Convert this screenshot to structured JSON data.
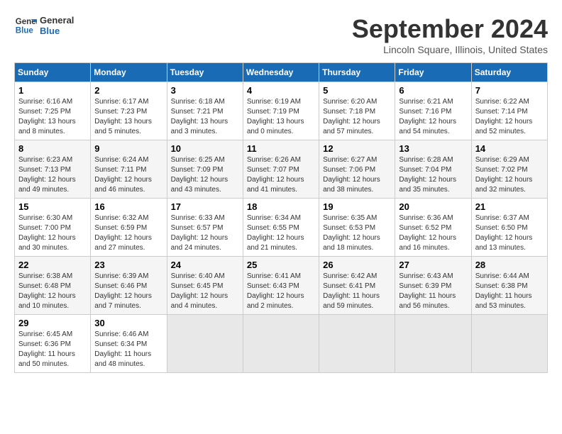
{
  "logo": {
    "line1": "General",
    "line2": "Blue"
  },
  "title": "September 2024",
  "location": "Lincoln Square, Illinois, United States",
  "headers": [
    "Sunday",
    "Monday",
    "Tuesday",
    "Wednesday",
    "Thursday",
    "Friday",
    "Saturday"
  ],
  "weeks": [
    [
      {
        "day": "1",
        "sunrise": "6:16 AM",
        "sunset": "7:25 PM",
        "daylight": "13 hours and 8 minutes."
      },
      {
        "day": "2",
        "sunrise": "6:17 AM",
        "sunset": "7:23 PM",
        "daylight": "13 hours and 5 minutes."
      },
      {
        "day": "3",
        "sunrise": "6:18 AM",
        "sunset": "7:21 PM",
        "daylight": "13 hours and 3 minutes."
      },
      {
        "day": "4",
        "sunrise": "6:19 AM",
        "sunset": "7:19 PM",
        "daylight": "13 hours and 0 minutes."
      },
      {
        "day": "5",
        "sunrise": "6:20 AM",
        "sunset": "7:18 PM",
        "daylight": "12 hours and 57 minutes."
      },
      {
        "day": "6",
        "sunrise": "6:21 AM",
        "sunset": "7:16 PM",
        "daylight": "12 hours and 54 minutes."
      },
      {
        "day": "7",
        "sunrise": "6:22 AM",
        "sunset": "7:14 PM",
        "daylight": "12 hours and 52 minutes."
      }
    ],
    [
      {
        "day": "8",
        "sunrise": "6:23 AM",
        "sunset": "7:13 PM",
        "daylight": "12 hours and 49 minutes."
      },
      {
        "day": "9",
        "sunrise": "6:24 AM",
        "sunset": "7:11 PM",
        "daylight": "12 hours and 46 minutes."
      },
      {
        "day": "10",
        "sunrise": "6:25 AM",
        "sunset": "7:09 PM",
        "daylight": "12 hours and 43 minutes."
      },
      {
        "day": "11",
        "sunrise": "6:26 AM",
        "sunset": "7:07 PM",
        "daylight": "12 hours and 41 minutes."
      },
      {
        "day": "12",
        "sunrise": "6:27 AM",
        "sunset": "7:06 PM",
        "daylight": "12 hours and 38 minutes."
      },
      {
        "day": "13",
        "sunrise": "6:28 AM",
        "sunset": "7:04 PM",
        "daylight": "12 hours and 35 minutes."
      },
      {
        "day": "14",
        "sunrise": "6:29 AM",
        "sunset": "7:02 PM",
        "daylight": "12 hours and 32 minutes."
      }
    ],
    [
      {
        "day": "15",
        "sunrise": "6:30 AM",
        "sunset": "7:00 PM",
        "daylight": "12 hours and 30 minutes."
      },
      {
        "day": "16",
        "sunrise": "6:32 AM",
        "sunset": "6:59 PM",
        "daylight": "12 hours and 27 minutes."
      },
      {
        "day": "17",
        "sunrise": "6:33 AM",
        "sunset": "6:57 PM",
        "daylight": "12 hours and 24 minutes."
      },
      {
        "day": "18",
        "sunrise": "6:34 AM",
        "sunset": "6:55 PM",
        "daylight": "12 hours and 21 minutes."
      },
      {
        "day": "19",
        "sunrise": "6:35 AM",
        "sunset": "6:53 PM",
        "daylight": "12 hours and 18 minutes."
      },
      {
        "day": "20",
        "sunrise": "6:36 AM",
        "sunset": "6:52 PM",
        "daylight": "12 hours and 16 minutes."
      },
      {
        "day": "21",
        "sunrise": "6:37 AM",
        "sunset": "6:50 PM",
        "daylight": "12 hours and 13 minutes."
      }
    ],
    [
      {
        "day": "22",
        "sunrise": "6:38 AM",
        "sunset": "6:48 PM",
        "daylight": "12 hours and 10 minutes."
      },
      {
        "day": "23",
        "sunrise": "6:39 AM",
        "sunset": "6:46 PM",
        "daylight": "12 hours and 7 minutes."
      },
      {
        "day": "24",
        "sunrise": "6:40 AM",
        "sunset": "6:45 PM",
        "daylight": "12 hours and 4 minutes."
      },
      {
        "day": "25",
        "sunrise": "6:41 AM",
        "sunset": "6:43 PM",
        "daylight": "12 hours and 2 minutes."
      },
      {
        "day": "26",
        "sunrise": "6:42 AM",
        "sunset": "6:41 PM",
        "daylight": "11 hours and 59 minutes."
      },
      {
        "day": "27",
        "sunrise": "6:43 AM",
        "sunset": "6:39 PM",
        "daylight": "11 hours and 56 minutes."
      },
      {
        "day": "28",
        "sunrise": "6:44 AM",
        "sunset": "6:38 PM",
        "daylight": "11 hours and 53 minutes."
      }
    ],
    [
      {
        "day": "29",
        "sunrise": "6:45 AM",
        "sunset": "6:36 PM",
        "daylight": "11 hours and 50 minutes."
      },
      {
        "day": "30",
        "sunrise": "6:46 AM",
        "sunset": "6:34 PM",
        "daylight": "11 hours and 48 minutes."
      },
      null,
      null,
      null,
      null,
      null
    ]
  ]
}
